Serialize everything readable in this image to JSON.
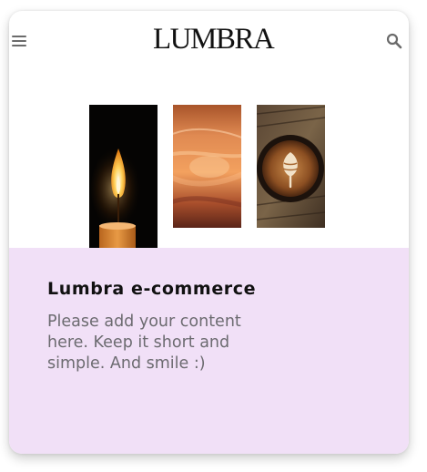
{
  "header": {
    "logo_text": "LUMBRA",
    "menu_icon": "hamburger-menu-icon",
    "search_icon": "search-icon"
  },
  "gallery": {
    "images": [
      "candle-flame",
      "orange-candle-wax",
      "latte-art-coffee"
    ]
  },
  "content": {
    "title": "Lumbra e-commerce",
    "body": "Please add your content here. Keep it short and simple. And smile :)"
  },
  "colors": {
    "panel_background": "#f1e0f7",
    "icon_gray": "#6b6b6b",
    "body_text": "#6c6b70"
  }
}
